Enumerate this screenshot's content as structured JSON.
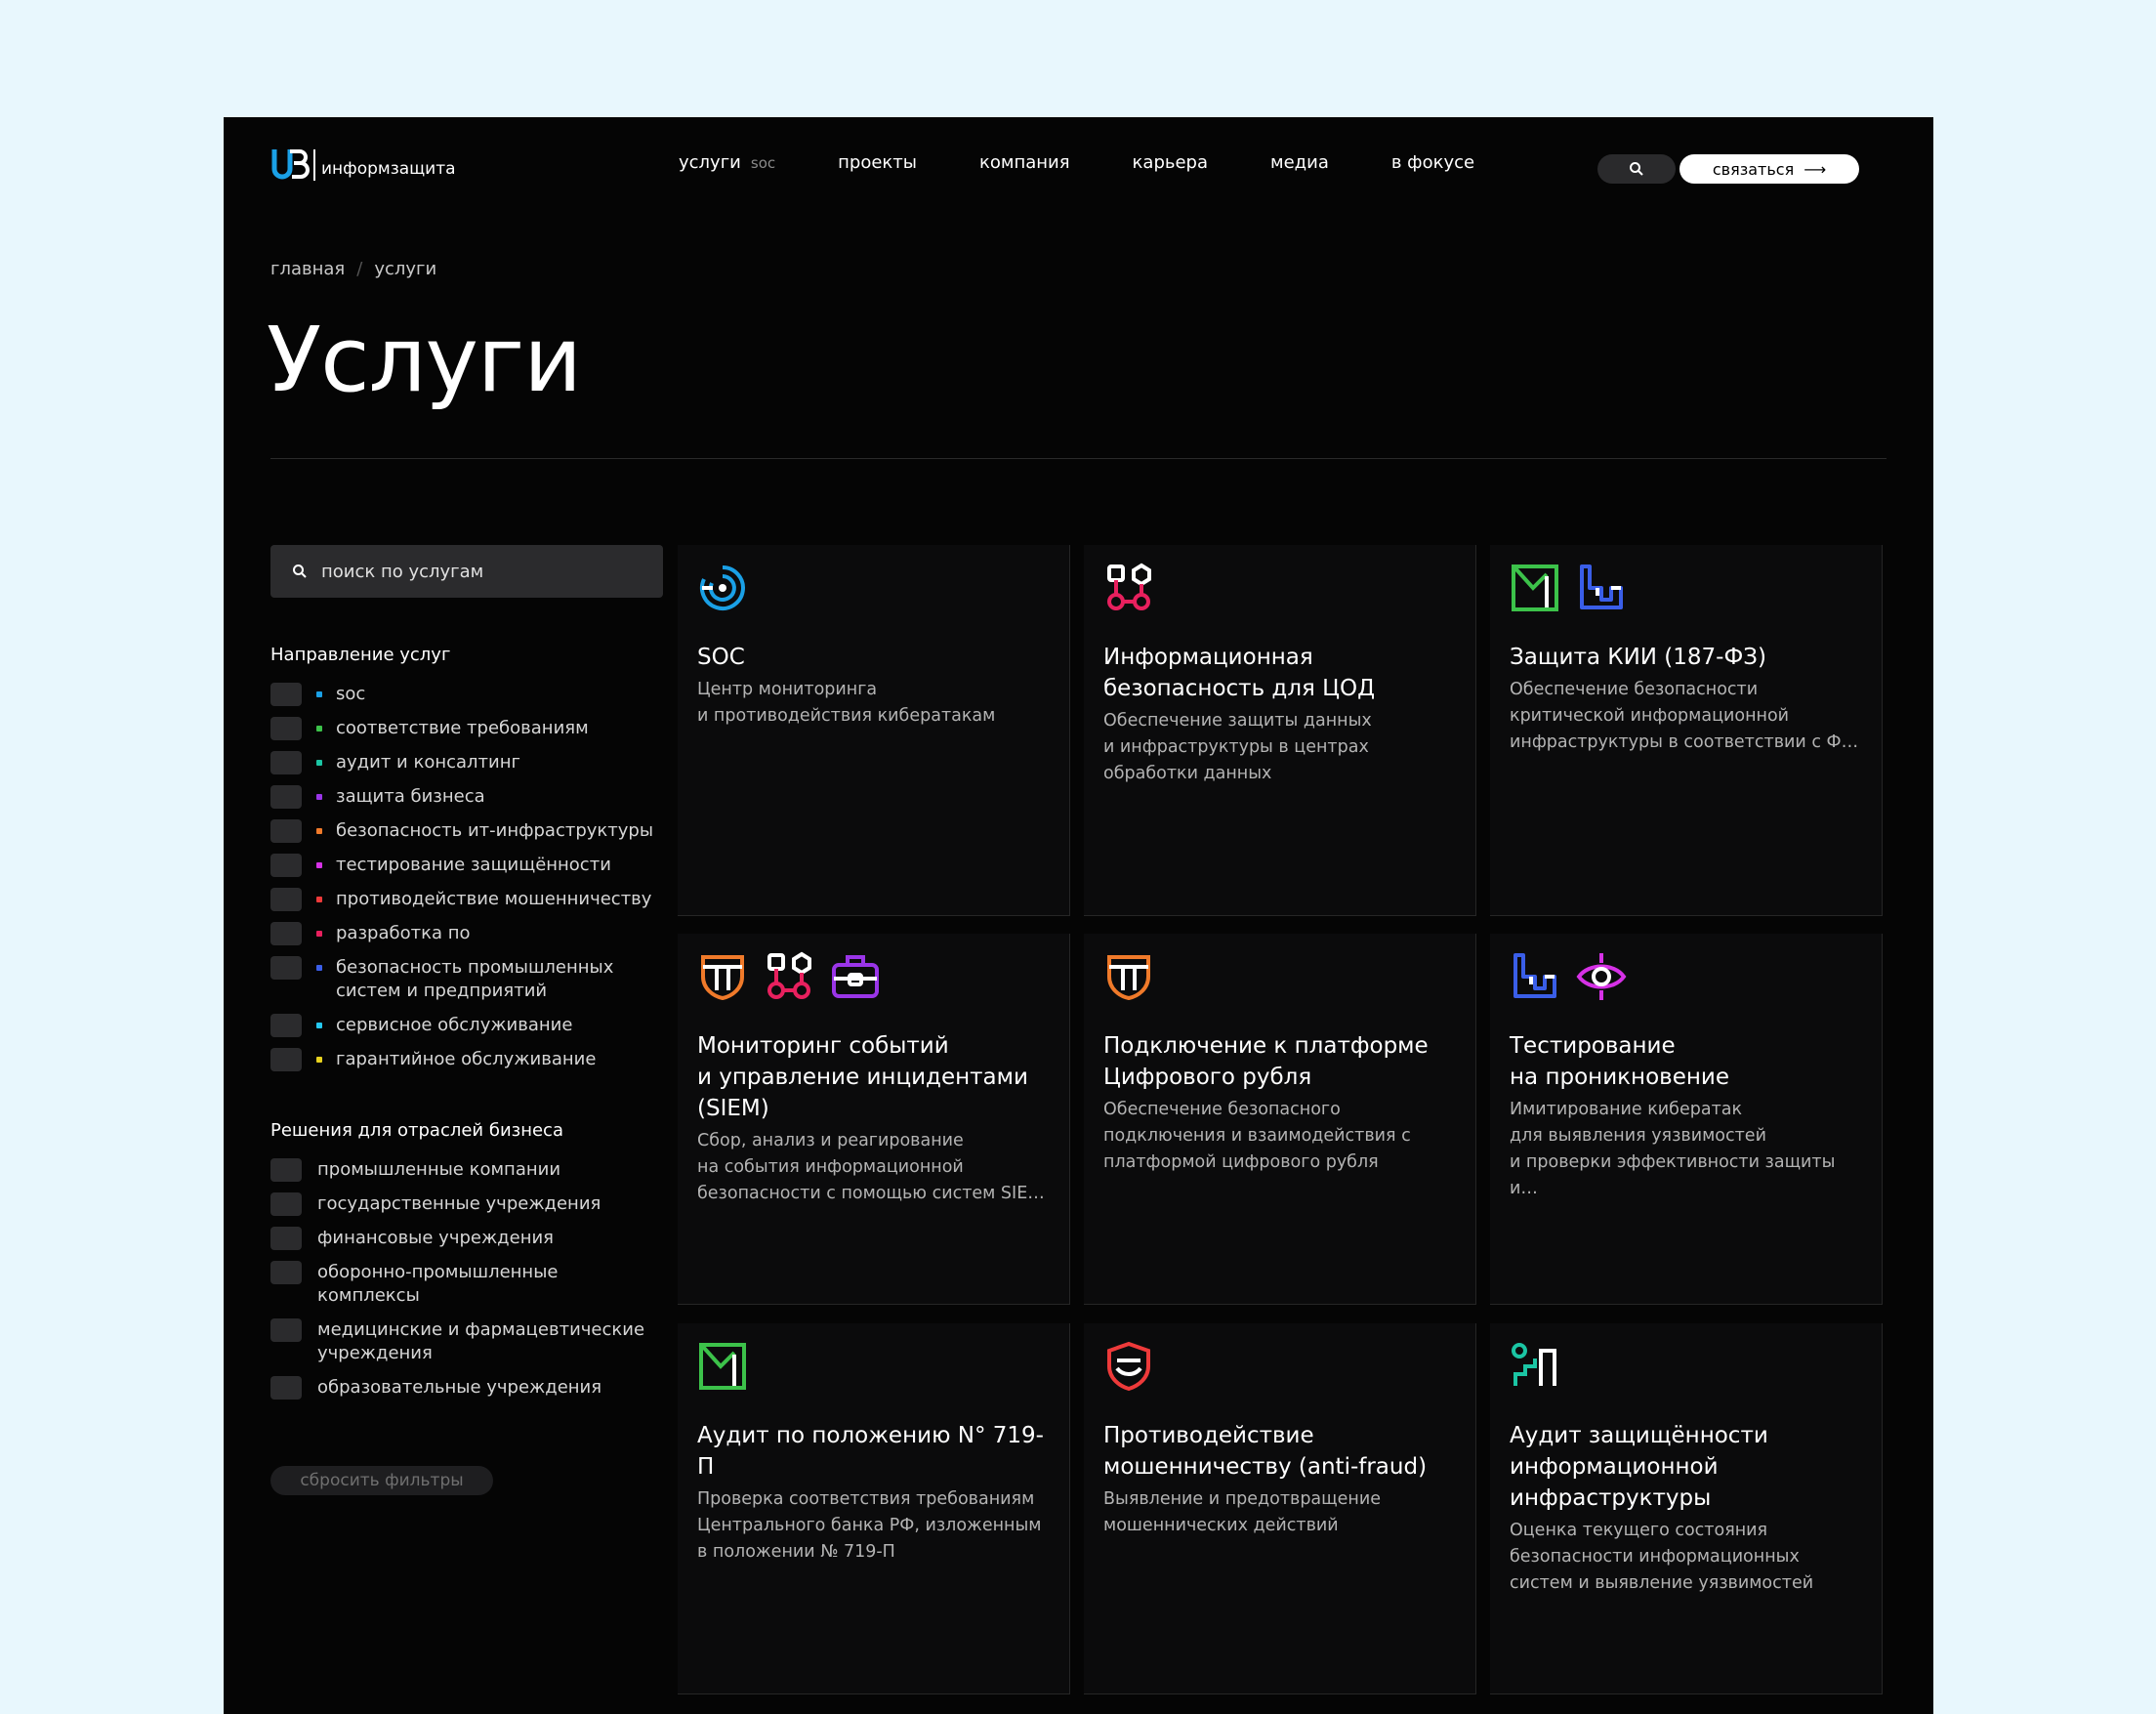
{
  "brand": {
    "name": "информзащита"
  },
  "nav": {
    "items": [
      {
        "label": "услуги",
        "sub": "soc"
      },
      {
        "label": "проекты",
        "sub": ""
      },
      {
        "label": "компания",
        "sub": ""
      },
      {
        "label": "карьера",
        "sub": ""
      },
      {
        "label": "медиа",
        "sub": ""
      },
      {
        "label": "в фокусе",
        "sub": ""
      }
    ],
    "contact_label": "связаться",
    "contact_arrow": "⟶"
  },
  "breadcrumb": {
    "home": "главная",
    "sep": "/",
    "current": "услуги"
  },
  "page": {
    "title": "Услуги"
  },
  "sidebar": {
    "search_placeholder": "поиск по услугам",
    "group1_title": "Направление услуг",
    "directions": [
      {
        "label": "soc",
        "color": "#1aa0e6"
      },
      {
        "label": "соответствие требованиям",
        "color": "#3cc24a"
      },
      {
        "label": "аудит и консалтинг",
        "color": "#1bc5a4"
      },
      {
        "label": "защита бизнеса",
        "color": "#9a35e8"
      },
      {
        "label": "безопасность ит-инфраструктуры",
        "color": "#f07a2a"
      },
      {
        "label": "тестирование защищённости",
        "color": "#d631e6"
      },
      {
        "label": "противодействие мошенничеству",
        "color": "#ee3a3a"
      },
      {
        "label": "разработка по",
        "color": "#e8205e"
      },
      {
        "label": "безопасность промышленных систем и предприятий",
        "color": "#3a5ee8"
      },
      {
        "label": "сервисное обслуживание",
        "color": "#25c8f0"
      },
      {
        "label": "гарантийное обслуживание",
        "color": "#e8d21f"
      }
    ],
    "group2_title": "Решения для отраслей бизнеса",
    "industries": [
      "промышленные компании",
      "государственные учреждения",
      "финансовые учреждения",
      "оборонно-промышленные комплексы",
      "медицинские и фармацевтические учреждения",
      "образовательные учреждения"
    ],
    "reset_label": "сбросить фильтры"
  },
  "cards": [
    {
      "title": "SOC",
      "desc": "Центр мониторинга\nи противодействия кибератакам"
    },
    {
      "title": "Информационная безопасность для ЦОД",
      "desc": "Обеспечение защиты данных\nи инфраструктуры в центрах обработки данных"
    },
    {
      "title": "Защита КИИ (187-ФЗ)",
      "desc": "Обеспечение безопасности критической информационной инфраструктуры в соответствии с Ф…"
    },
    {
      "title": "Мониторинг событий\nи управление инцидентами (SIEM)",
      "desc": "Сбор, анализ и реагирование\nна события информационной безопасности с помощью систем SIE…"
    },
    {
      "title": "Подключение к платформе Цифрового рубля",
      "desc": "Обеспечение безопасного подключения и взаимодействия с платформой цифрового рубля"
    },
    {
      "title": "Тестирование\nна проникновение",
      "desc": "Имитирование кибератак\nдля выявления уязвимостей\nи проверки эффективности защиты и…"
    },
    {
      "title": "Аудит по положению N° 719-П",
      "desc": "Проверка соответствия требованиям Центрального банка РФ, изложенным в положении № 719-П"
    },
    {
      "title": "Противодействие мошенничеству (anti-fraud)",
      "desc": "Выявление и предотвращение мошеннических действий"
    },
    {
      "title": "Аудит защищённости информационной инфраструктуры",
      "desc": "Оценка текущего состояния безопасности информационных систем и выявление уязвимостей"
    }
  ],
  "icon_colors": {
    "soc": "#1aa0e6",
    "dc": "#e8205e",
    "compliance": "#3cc24a",
    "industrial": "#3a5ee8",
    "infra": "#f07a2a",
    "business": "#9a35e8",
    "pentest": "#d631e6",
    "fraud": "#ee3a3a",
    "audit": "#1bc5a4"
  }
}
